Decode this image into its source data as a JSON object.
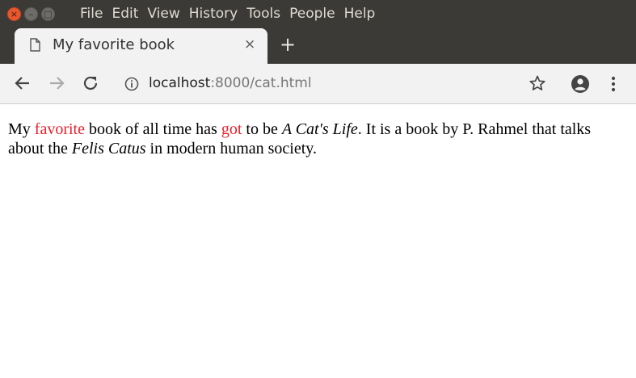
{
  "menu": [
    "File",
    "Edit",
    "View",
    "History",
    "Tools",
    "People",
    "Help"
  ],
  "window_buttons": {
    "close": "×",
    "minimize": "–",
    "maximize": "▢"
  },
  "tab": {
    "title": "My favorite book",
    "close": "×",
    "new_tab": "+"
  },
  "address": {
    "host": "localhost",
    "rest": ":8000/cat.html"
  },
  "icons": {
    "back": "back-arrow-icon",
    "forward": "forward-arrow-icon",
    "reload": "reload-icon",
    "info": "info-icon",
    "star": "star-icon",
    "profile": "profile-icon",
    "menu": "kebab-menu-icon"
  },
  "content": {
    "p1": "My ",
    "r1": "favorite",
    "p2": " book of all time has ",
    "r2": "got",
    "p3": " to be ",
    "i1": "A Cat's Life",
    "p4": ". It is a book by P. Rahmel that talks about the ",
    "i2": "Felis Catus",
    "p5": " in modern human society."
  },
  "colors": {
    "highlight": "#e8202a",
    "titlebar": "#3b3a36",
    "toolbar": "#f2f2f2"
  }
}
